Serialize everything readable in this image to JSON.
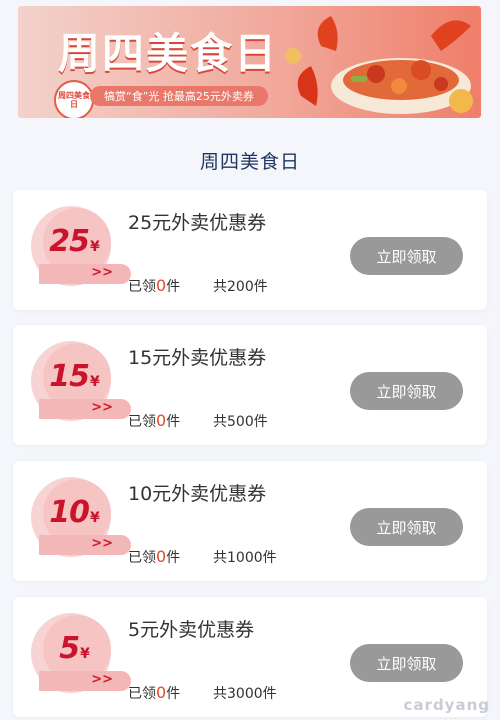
{
  "banner": {
    "title": "周四美食日",
    "badge_text": "周四美食日",
    "tagline": "犒赏“食”光 抢最高25元外卖券"
  },
  "section_title": "周四美食日",
  "coupons": [
    {
      "amount": "25",
      "currency": "¥",
      "arrow": ">>",
      "name": "25元外卖优惠券",
      "claimed_prefix": "已领",
      "claimed_count": "0",
      "claimed_suffix": "件",
      "total": "共200件",
      "button": "立即领取"
    },
    {
      "amount": "15",
      "currency": "¥",
      "arrow": ">>",
      "name": "15元外卖优惠券",
      "claimed_prefix": "已领",
      "claimed_count": "0",
      "claimed_suffix": "件",
      "total": "共500件",
      "button": "立即领取"
    },
    {
      "amount": "10",
      "currency": "¥",
      "arrow": ">>",
      "name": "10元外卖优惠券",
      "claimed_prefix": "已领",
      "claimed_count": "0",
      "claimed_suffix": "件",
      "total": "共1000件",
      "button": "立即领取"
    },
    {
      "amount": "5",
      "currency": "¥",
      "arrow": ">>",
      "name": "5元外卖优惠券",
      "claimed_prefix": "已领",
      "claimed_count": "0",
      "claimed_suffix": "件",
      "total": "共3000件",
      "button": "立即领取"
    }
  ],
  "watermark": "cardyang",
  "colors": {
    "accent_red": "#c9142b",
    "count_orange": "#e24a2d",
    "button_disabled": "#999999",
    "section_title": "#1f3660"
  }
}
